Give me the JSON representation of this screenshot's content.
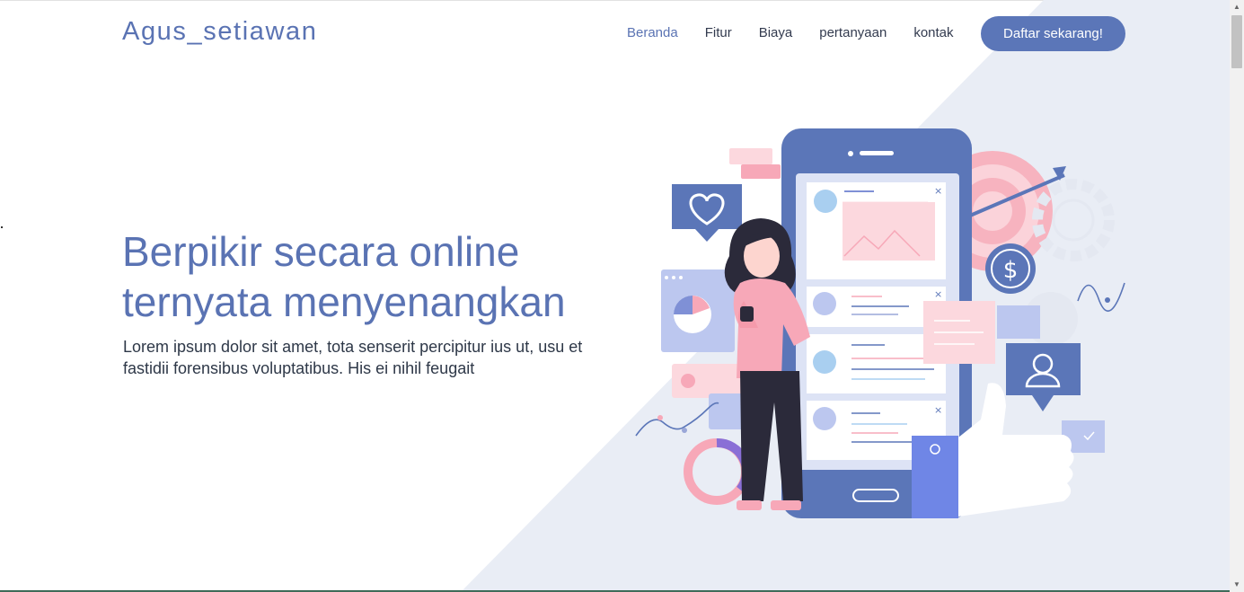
{
  "brand": "Agus_setiawan",
  "nav": {
    "items": [
      {
        "label": "Beranda",
        "active": true
      },
      {
        "label": "Fitur",
        "active": false
      },
      {
        "label": "Biaya",
        "active": false
      },
      {
        "label": "pertanyaan",
        "active": false
      },
      {
        "label": "kontak",
        "active": false
      }
    ],
    "cta": "Daftar sekarang!"
  },
  "hero": {
    "title_line1": "Berpikir secara online",
    "title_line2": "ternyata menyenangkan",
    "description": "Lorem ipsum dolor sit amet, tota senserit percipitur ius ut, usu et fastidii forensibus voluptatibus. His ei nihil feugait"
  },
  "illustration": {
    "dollar_symbol": "$"
  },
  "colors": {
    "primary": "#5b76b8",
    "text_dark": "#2e3848",
    "bg_diagonal": "#e9edf5",
    "pink": "#f7a8b8"
  }
}
